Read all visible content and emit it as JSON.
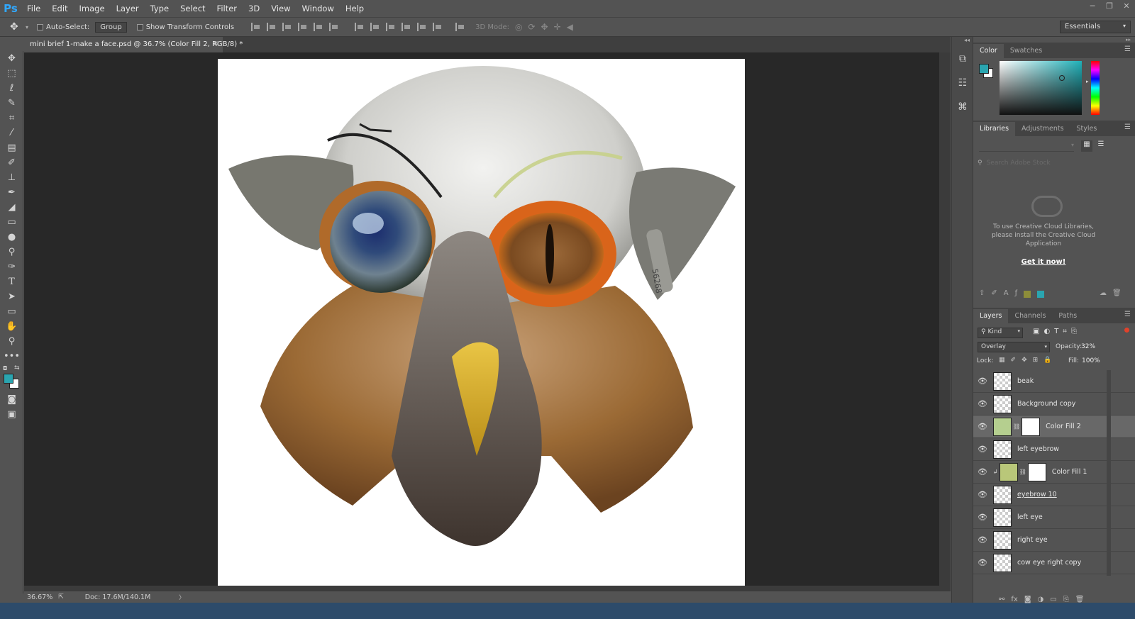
{
  "app": {
    "logo": "Ps"
  },
  "menu": [
    "File",
    "Edit",
    "Image",
    "Layer",
    "Type",
    "Select",
    "Filter",
    "3D",
    "View",
    "Window",
    "Help"
  ],
  "options_bar": {
    "auto_select_label": "Auto-Select:",
    "auto_select_value": "Group",
    "transform_controls_label": "Show Transform Controls",
    "mode_3d_label": "3D Mode:",
    "workspace": "Essentials"
  },
  "document": {
    "tab_title": "mini brief 1-make a face.psd @ 36.7% (Color Fill 2, RGB/8) *"
  },
  "status": {
    "zoom": "36.67%",
    "doc_size": "Doc: 17.6M/140.1M"
  },
  "colors": {
    "foreground": "#2aa5b0",
    "background": "#ffffff",
    "picker_dot": "#2aa5b0"
  },
  "color_panel": {
    "tabs": [
      "Color",
      "Swatches"
    ]
  },
  "libraries_panel": {
    "tabs": [
      "Libraries",
      "Adjustments",
      "Styles"
    ],
    "search_placeholder": "Search Adobe Stock",
    "message": "To use Creative Cloud Libraries, please install the Creative Cloud Application",
    "link": "Get it now!"
  },
  "layers_panel": {
    "tabs": [
      "Layers",
      "Channels",
      "Paths"
    ],
    "filter_kind": "Kind",
    "blend_mode": "Overlay",
    "opacity_label": "Opacity:",
    "opacity": "32%",
    "lock_label": "Lock:",
    "fill_label": "Fill:",
    "fill": "100%",
    "layers": [
      {
        "name": "beak",
        "thumb": "transparent"
      },
      {
        "name": "Background copy",
        "thumb": "transparent"
      },
      {
        "name": "Color Fill 2",
        "thumb": "#b5cf8f",
        "selected": true,
        "mask": true
      },
      {
        "name": "left eyebrow",
        "thumb": "transparent"
      },
      {
        "name": "Color Fill 1",
        "thumb": "#b9c779",
        "mask": true,
        "clipped": true
      },
      {
        "name": "eyebrow 10",
        "thumb": "transparent",
        "underline": true
      },
      {
        "name": "left eye",
        "thumb": "transparent"
      },
      {
        "name": "right eye",
        "thumb": "transparent"
      },
      {
        "name": "cow eye right copy",
        "thumb": "transparent"
      }
    ]
  },
  "artwork": {
    "ear_tag_number": "56268"
  }
}
